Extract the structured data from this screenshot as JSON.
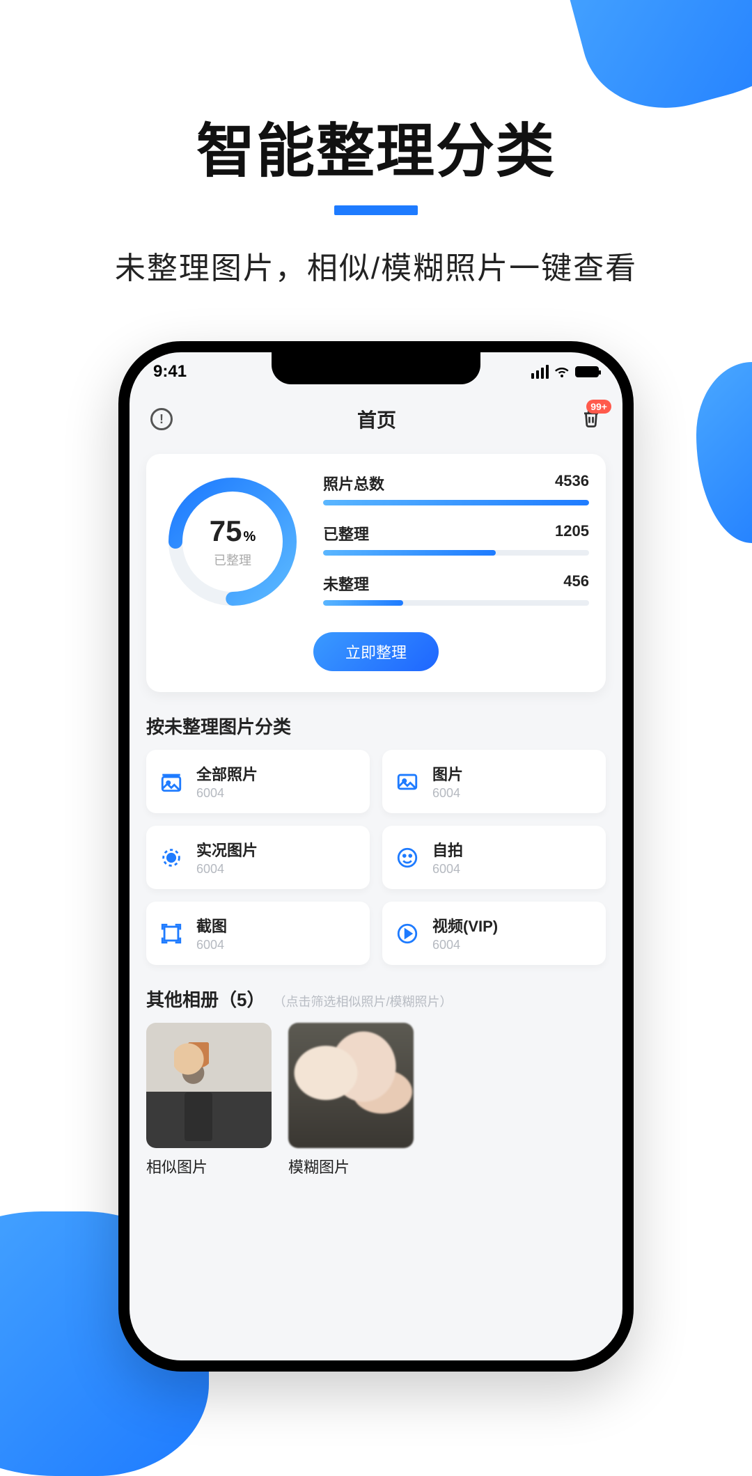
{
  "hero": {
    "title": "智能整理分类",
    "subtitle": "未整理图片，相似/模糊照片一键查看"
  },
  "status": {
    "time": "9:41"
  },
  "header": {
    "title": "首页",
    "badge": "99+"
  },
  "ring": {
    "value": "75",
    "unit": "%",
    "label": "已整理",
    "percent": 75
  },
  "stats": [
    {
      "label": "照片总数",
      "value": "4536",
      "fill": "w100"
    },
    {
      "label": "已整理",
      "value": "1205",
      "fill": "w65"
    },
    {
      "label": "未整理",
      "value": "456",
      "fill": "w30"
    }
  ],
  "cta": "立即整理",
  "section_unsorted": "按未整理图片分类",
  "categories": [
    {
      "name": "全部照片",
      "count": "6004",
      "icon": "photos-icon"
    },
    {
      "name": "图片",
      "count": "6004",
      "icon": "image-icon"
    },
    {
      "name": "实况图片",
      "count": "6004",
      "icon": "live-icon"
    },
    {
      "name": "自拍",
      "count": "6004",
      "icon": "selfie-icon"
    },
    {
      "name": "截图",
      "count": "6004",
      "icon": "screenshot-icon"
    },
    {
      "name": "视频(VIP)",
      "count": "6004",
      "icon": "video-icon"
    }
  ],
  "other": {
    "title": "其他相册（5）",
    "hint": "（点击筛选相似照片/模糊照片）"
  },
  "albums": [
    {
      "label": "相似图片"
    },
    {
      "label": "模糊图片"
    }
  ]
}
